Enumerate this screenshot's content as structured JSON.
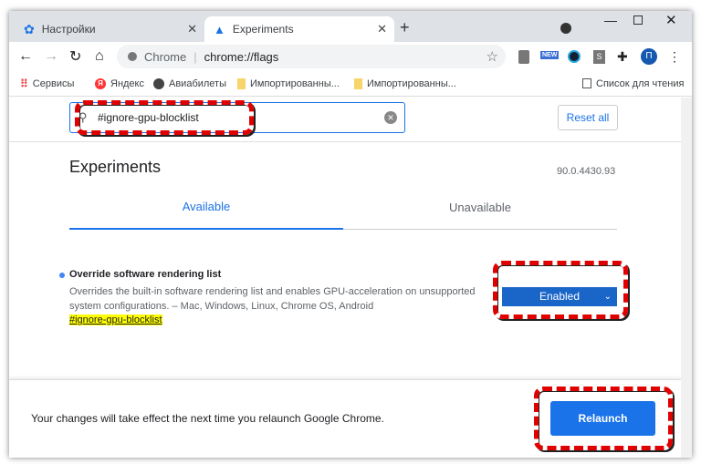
{
  "tabs": [
    {
      "label": "Настройки",
      "icon": "gear-icon"
    },
    {
      "label": "Experiments",
      "icon": "flask-icon"
    }
  ],
  "omnibox": {
    "site": "Chrome",
    "url": "chrome://flags"
  },
  "bookmarks": [
    {
      "label": "Сервисы"
    },
    {
      "label": "Яндекс"
    },
    {
      "label": "Авиабилеты"
    },
    {
      "label": "Импортированны..."
    },
    {
      "label": "Импортированны..."
    }
  ],
  "reading_list": "Список для чтения",
  "extensions": {
    "new_badge": "NEW",
    "s_label": "S",
    "avatar": "П"
  },
  "search": {
    "value": "#ignore-gpu-blocklist"
  },
  "reset_label": "Reset all",
  "title": "Experiments",
  "version": "90.0.4430.93",
  "tab_available": "Available",
  "tab_unavailable": "Unavailable",
  "flag": {
    "name": "Override software rendering list",
    "desc1": "Overrides the built-in software rendering list and enables GPU-acceleration on unsupported",
    "desc2": "system configurations. – Mac, Windows, Linux, Chrome OS, Android",
    "link": "#ignore-gpu-blocklist",
    "value": "Enabled"
  },
  "footer": {
    "message": "Your changes will take effect the next time you relaunch Google Chrome.",
    "relaunch": "Relaunch"
  },
  "colors": {
    "accent": "#1a73e8",
    "select": "#1a65c8",
    "annotation": "#e00000",
    "highlight": "#ffff00"
  }
}
